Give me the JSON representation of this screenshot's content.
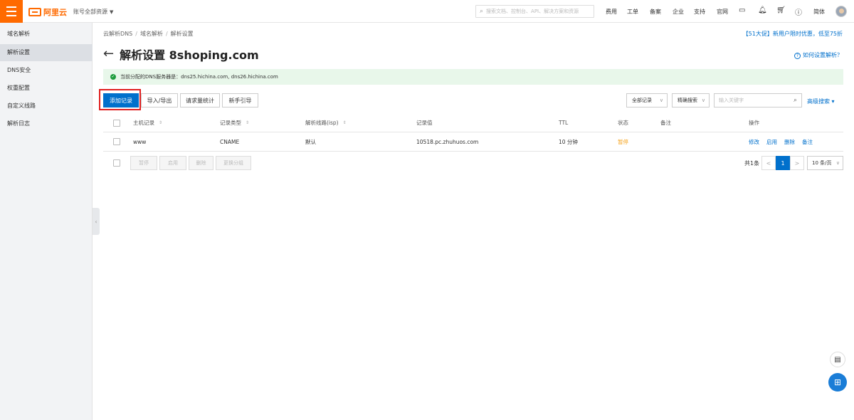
{
  "header": {
    "brand": "阿里云",
    "account_scope": "账号全部资源",
    "search_placeholder": "搜索文档、控制台、API、解决方案和资源",
    "nav": [
      "费用",
      "工单",
      "备案",
      "企业",
      "支持",
      "官网"
    ],
    "language": "简体",
    "icons": [
      "terminal-icon",
      "bell-icon",
      "cart-icon",
      "help-icon"
    ]
  },
  "sidebar": {
    "title": "域名解析",
    "items": [
      {
        "label": "解析设置",
        "active": true
      },
      {
        "label": "DNS安全",
        "active": false
      },
      {
        "label": "权重配置",
        "active": false
      },
      {
        "label": "自定义线路",
        "active": false
      },
      {
        "label": "解析日志",
        "active": false
      }
    ]
  },
  "breadcrumb": [
    "云解析DNS",
    "域名解析",
    "解析设置"
  ],
  "promo": "【51大促】新用户限时优惠，低至75折",
  "page": {
    "title": "解析设置 8shoping.com",
    "help": "如何设置解析？"
  },
  "notice": "当前分配的DNS服务器是：dns25.hichina.com, dns26.hichina.com",
  "toolbar": {
    "add": "添加记录",
    "import_export": "导入/导出",
    "stats": "请求量统计",
    "guide": "新手引导",
    "record_filter": "全部记录",
    "search_mode": "精确搜索",
    "keyword_placeholder": "输入关键字",
    "advanced": "高级搜索"
  },
  "table": {
    "columns": [
      "主机记录",
      "记录类型",
      "解析线路(isp)",
      "记录值",
      "TTL",
      "状态",
      "备注",
      "操作"
    ],
    "rows": [
      {
        "host": "www",
        "type": "CNAME",
        "line": "默认",
        "value": "10518.pc.zhuhuos.com",
        "ttl": "10 分钟",
        "status": "暂停",
        "remark": "",
        "actions": [
          "修改",
          "启用",
          "删除",
          "备注"
        ]
      }
    ]
  },
  "bulk_actions": [
    "暂停",
    "启用",
    "删除",
    "更换分组"
  ],
  "pagination": {
    "total": "共1条",
    "current": "1",
    "prev": "<",
    "next": ">",
    "page_size": "10 条/页"
  },
  "colors": {
    "brand_orange": "#ff6a00",
    "primary_blue": "#0070cc",
    "highlight_red": "#e02020",
    "paused_orange": "#f5a623",
    "notice_green": "#e8f7ea"
  }
}
